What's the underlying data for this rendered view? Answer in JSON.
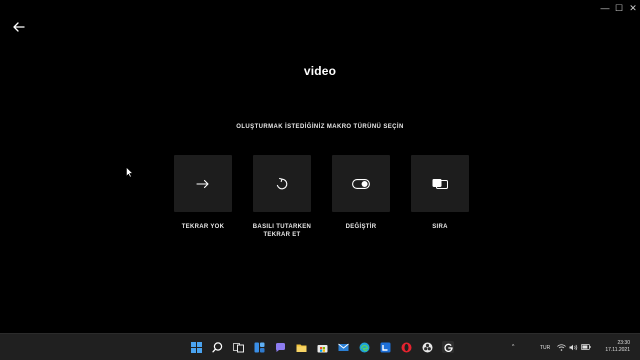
{
  "window": {
    "minimize": "—",
    "maximize": "☐",
    "close": "✕"
  },
  "page": {
    "title": "video",
    "subtitle": "OLUŞTURMAK İSTEDİĞİNİZ MAKRO TÜRÜNÜ SEÇİN"
  },
  "options": [
    {
      "label": "TEKRAR YOK",
      "icon": "arrow-right-icon"
    },
    {
      "label": "BASILI TUTARKEN\nTEKRAR ET",
      "icon": "repeat-while-held-icon"
    },
    {
      "label": "DEĞİŞTİR",
      "icon": "toggle-icon"
    },
    {
      "label": "SIRA",
      "icon": "sequence-icon"
    }
  ],
  "taskbar": {
    "language": "TUR",
    "time": "23:30",
    "date": "17.11.2021",
    "apps": [
      "start-icon",
      "search-icon",
      "task-view-icon",
      "widgets-icon",
      "chat-icon",
      "file-explorer-icon",
      "store-icon",
      "mail-icon",
      "edge-icon",
      "office-icon",
      "opera-icon",
      "obs-icon",
      "logitech-ghub-icon"
    ]
  }
}
